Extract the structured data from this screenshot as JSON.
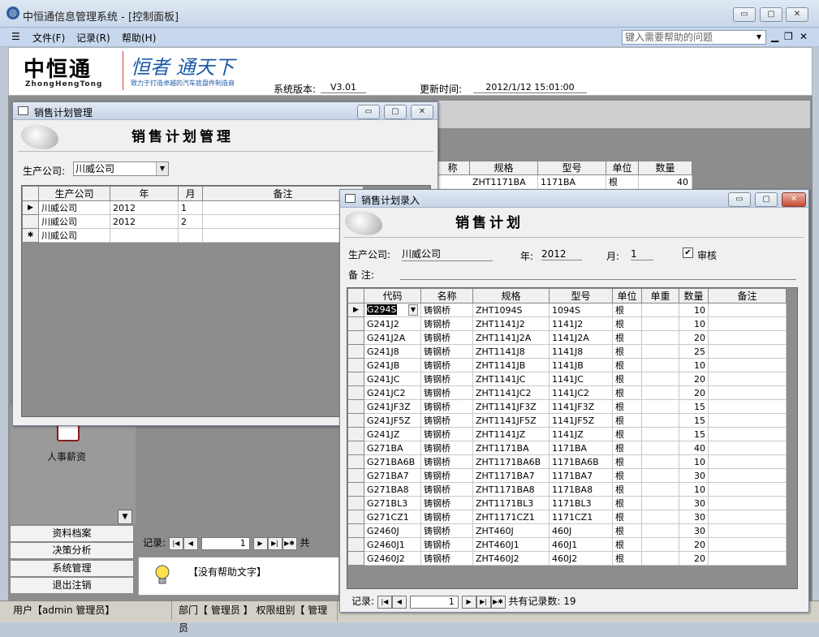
{
  "window": {
    "title": "中恒通信息管理系统 - [控制面板]"
  },
  "menu": {
    "file": "文件(F)",
    "record": "记录(R)",
    "help": "帮助(H)",
    "help_placeholder": "键入需要帮助的问题"
  },
  "header": {
    "logo_cn": "中恒通",
    "logo_en": "ZhongHengTong",
    "slogan": "恒者 通天下",
    "slogan_sub": "致力于打造卓越的汽车底盘件制造商",
    "version_label": "系统版本:",
    "version_value": "V3.01",
    "update_label": "更新时间:",
    "update_value": "2012/1/12 15:01:00"
  },
  "background_grid": {
    "headers": [
      "称",
      "规格",
      "型号",
      "单位",
      "数量"
    ],
    "row": [
      "",
      "ZHT1171BA",
      "1171BA",
      "根",
      "40"
    ]
  },
  "nav": {
    "icon_label": "人事薪资",
    "buttons": [
      "资料档案",
      "决策分析",
      "系统管理",
      "退出注销"
    ],
    "record_label": "记录:",
    "record_value": "1",
    "record_suffix": "共",
    "tip": "【没有帮助文字】"
  },
  "status": {
    "user": "用户【admin 管理员】",
    "dept": "部门【 管理员 】 权限组别【 管理员"
  },
  "plan_mgmt": {
    "title": "销售计划管理",
    "heading": "销售计划管理",
    "company_label": "生产公司:",
    "company_value": "川威公司",
    "columns": [
      "生产公司",
      "年",
      "月",
      "备注"
    ],
    "rows": [
      {
        "selector": "▶",
        "company": "川威公司",
        "year": "2012",
        "month": "1",
        "note": ""
      },
      {
        "selector": "",
        "company": "川威公司",
        "year": "2012",
        "month": "2",
        "note": ""
      },
      {
        "selector": "✱",
        "company": "川威公司",
        "year": "",
        "month": "",
        "note": ""
      }
    ]
  },
  "plan_entry": {
    "title": "销售计划录入",
    "heading": "销售计划",
    "company_label": "生产公司:",
    "company_value": "川威公司",
    "year_label": "年:",
    "year_value": "2012",
    "month_label": "月:",
    "month_value": "1",
    "audit_label": "审核",
    "audit_checked": "✔",
    "note_label": "备    注:",
    "columns": [
      "代码",
      "名称",
      "规格",
      "型号",
      "单位",
      "单重",
      "数量",
      "备注"
    ],
    "rows": [
      {
        "code": "G294S",
        "name": "铸钢桥",
        "spec": "ZHT1094S",
        "model": "1094S",
        "unit": "根",
        "qty": "10"
      },
      {
        "code": "G241J2",
        "name": "铸钢桥",
        "spec": "ZHT1141J2",
        "model": "1141J2",
        "unit": "根",
        "qty": "10"
      },
      {
        "code": "G241J2A",
        "name": "铸钢桥",
        "spec": "ZHT1141J2A",
        "model": "1141J2A",
        "unit": "根",
        "qty": "20"
      },
      {
        "code": "G241J8",
        "name": "铸钢桥",
        "spec": "ZHT1141J8",
        "model": "1141J8",
        "unit": "根",
        "qty": "25"
      },
      {
        "code": "G241JB",
        "name": "铸钢桥",
        "spec": "ZHT1141JB",
        "model": "1141JB",
        "unit": "根",
        "qty": "10"
      },
      {
        "code": "G241JC",
        "name": "铸钢桥",
        "spec": "ZHT1141JC",
        "model": "1141JC",
        "unit": "根",
        "qty": "20"
      },
      {
        "code": "G241JC2",
        "name": "铸钢桥",
        "spec": "ZHT1141JC2",
        "model": "1141JC2",
        "unit": "根",
        "qty": "20"
      },
      {
        "code": "G241JF3Z",
        "name": "铸钢桥",
        "spec": "ZHT1141JF3Z",
        "model": "1141JF3Z",
        "unit": "根",
        "qty": "15"
      },
      {
        "code": "G241JF5Z",
        "name": "铸钢桥",
        "spec": "ZHT1141JF5Z",
        "model": "1141JF5Z",
        "unit": "根",
        "qty": "15"
      },
      {
        "code": "G241JZ",
        "name": "铸钢桥",
        "spec": "ZHT1141JZ",
        "model": "1141JZ",
        "unit": "根",
        "qty": "15"
      },
      {
        "code": "G271BA",
        "name": "铸钢桥",
        "spec": "ZHT1171BA",
        "model": "1171BA",
        "unit": "根",
        "qty": "40"
      },
      {
        "code": "G271BA6B",
        "name": "铸钢桥",
        "spec": "ZHT1171BA6B",
        "model": "1171BA6B",
        "unit": "根",
        "qty": "10"
      },
      {
        "code": "G271BA7",
        "name": "铸钢桥",
        "spec": "ZHT1171BA7",
        "model": "1171BA7",
        "unit": "根",
        "qty": "30"
      },
      {
        "code": "G271BA8",
        "name": "铸钢桥",
        "spec": "ZHT1171BA8",
        "model": "1171BA8",
        "unit": "根",
        "qty": "10"
      },
      {
        "code": "G271BL3",
        "name": "铸钢桥",
        "spec": "ZHT1171BL3",
        "model": "1171BL3",
        "unit": "根",
        "qty": "30"
      },
      {
        "code": "G271CZ1",
        "name": "铸钢桥",
        "spec": "ZHT1171CZ1",
        "model": "1171CZ1",
        "unit": "根",
        "qty": "30"
      },
      {
        "code": "G2460J",
        "name": "铸钢桥",
        "spec": "ZHT460J",
        "model": "460J",
        "unit": "根",
        "qty": "30"
      },
      {
        "code": "G2460J1",
        "name": "铸钢桥",
        "spec": "ZHT460J1",
        "model": "460J1",
        "unit": "根",
        "qty": "20"
      },
      {
        "code": "G2460J2",
        "name": "铸钢桥",
        "spec": "ZHT460J2",
        "model": "460J2",
        "unit": "根",
        "qty": "20"
      }
    ],
    "record_label": "记录:",
    "record_value": "1",
    "total_label": "共有记录数: 19"
  }
}
